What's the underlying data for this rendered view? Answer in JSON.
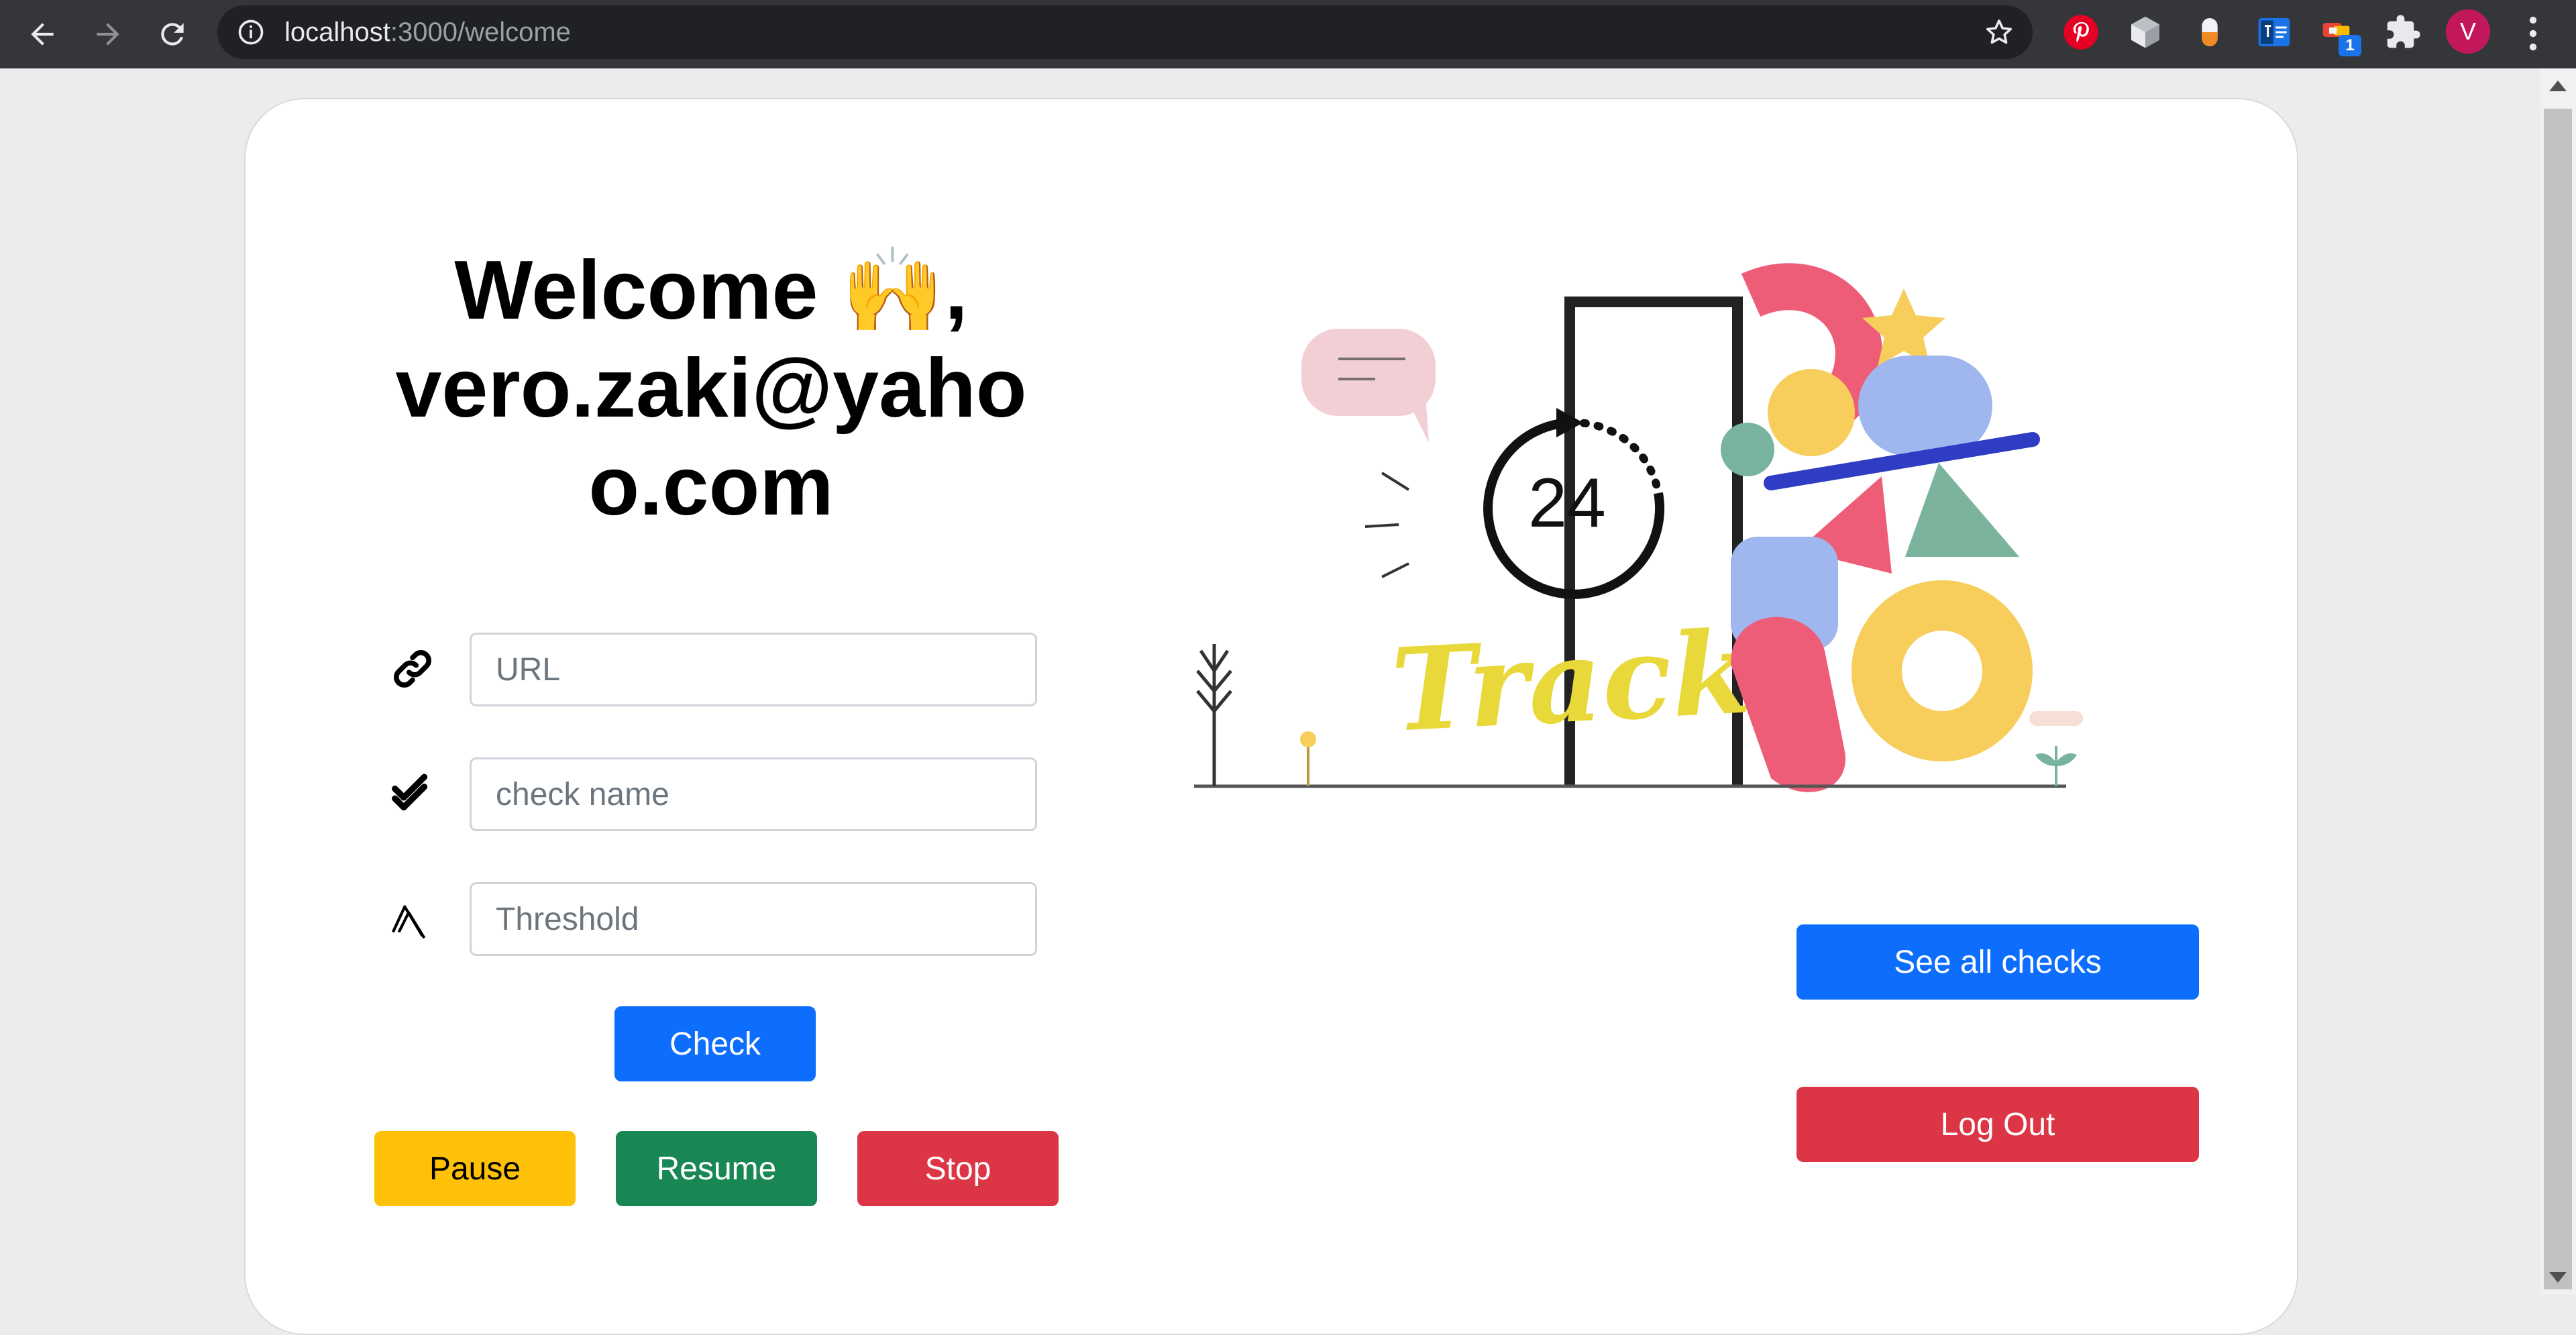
{
  "browser": {
    "url_host": "localhost",
    "url_path": ":3000/welcome",
    "avatar_letter": "V",
    "extension_badge": "1"
  },
  "welcome": {
    "greeting": "Welcome 🙌,",
    "email": "vero.zaki@yahoo.com"
  },
  "form": {
    "url_placeholder": "URL",
    "check_name_placeholder": "check name",
    "threshold_placeholder": "Threshold",
    "check_button": "Check"
  },
  "controls": {
    "pause": "Pause",
    "resume": "Resume",
    "stop": "Stop"
  },
  "actions": {
    "see_all_checks": "See all checks",
    "log_out": "Log Out"
  },
  "illustration": {
    "timer_value": "24",
    "caption": "Track"
  },
  "colors": {
    "primary": "#0d6efd",
    "warning": "#ffc107",
    "success": "#198754",
    "danger": "#dc3545"
  }
}
